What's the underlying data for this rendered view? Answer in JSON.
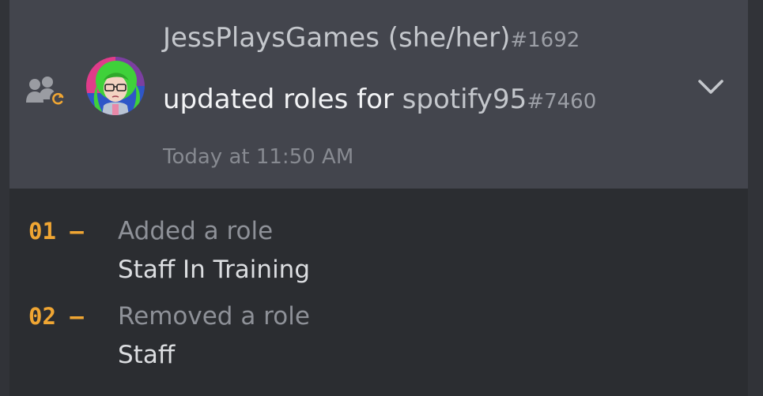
{
  "entry": {
    "actor": {
      "name": "JessPlaysGames (she/her)",
      "discriminator": "#1692"
    },
    "action": "updated roles for",
    "target": {
      "name": "spotify95",
      "discriminator": "#7460"
    },
    "timestamp": "Today at 11:50 AM",
    "icon": "member-role-update-icon",
    "expand_icon": "chevron-down-icon"
  },
  "changes": [
    {
      "number": "01 —",
      "label": "Added a role",
      "value": "Staff In Training"
    },
    {
      "number": "02 —",
      "label": "Removed a role",
      "value": "Staff"
    }
  ],
  "colors": {
    "card_bg": "#43454d",
    "panel_bg": "#2b2d31",
    "accent_number": "#f0a633",
    "text_primary": "#f2f3f5",
    "text_muted": "#878a91"
  }
}
